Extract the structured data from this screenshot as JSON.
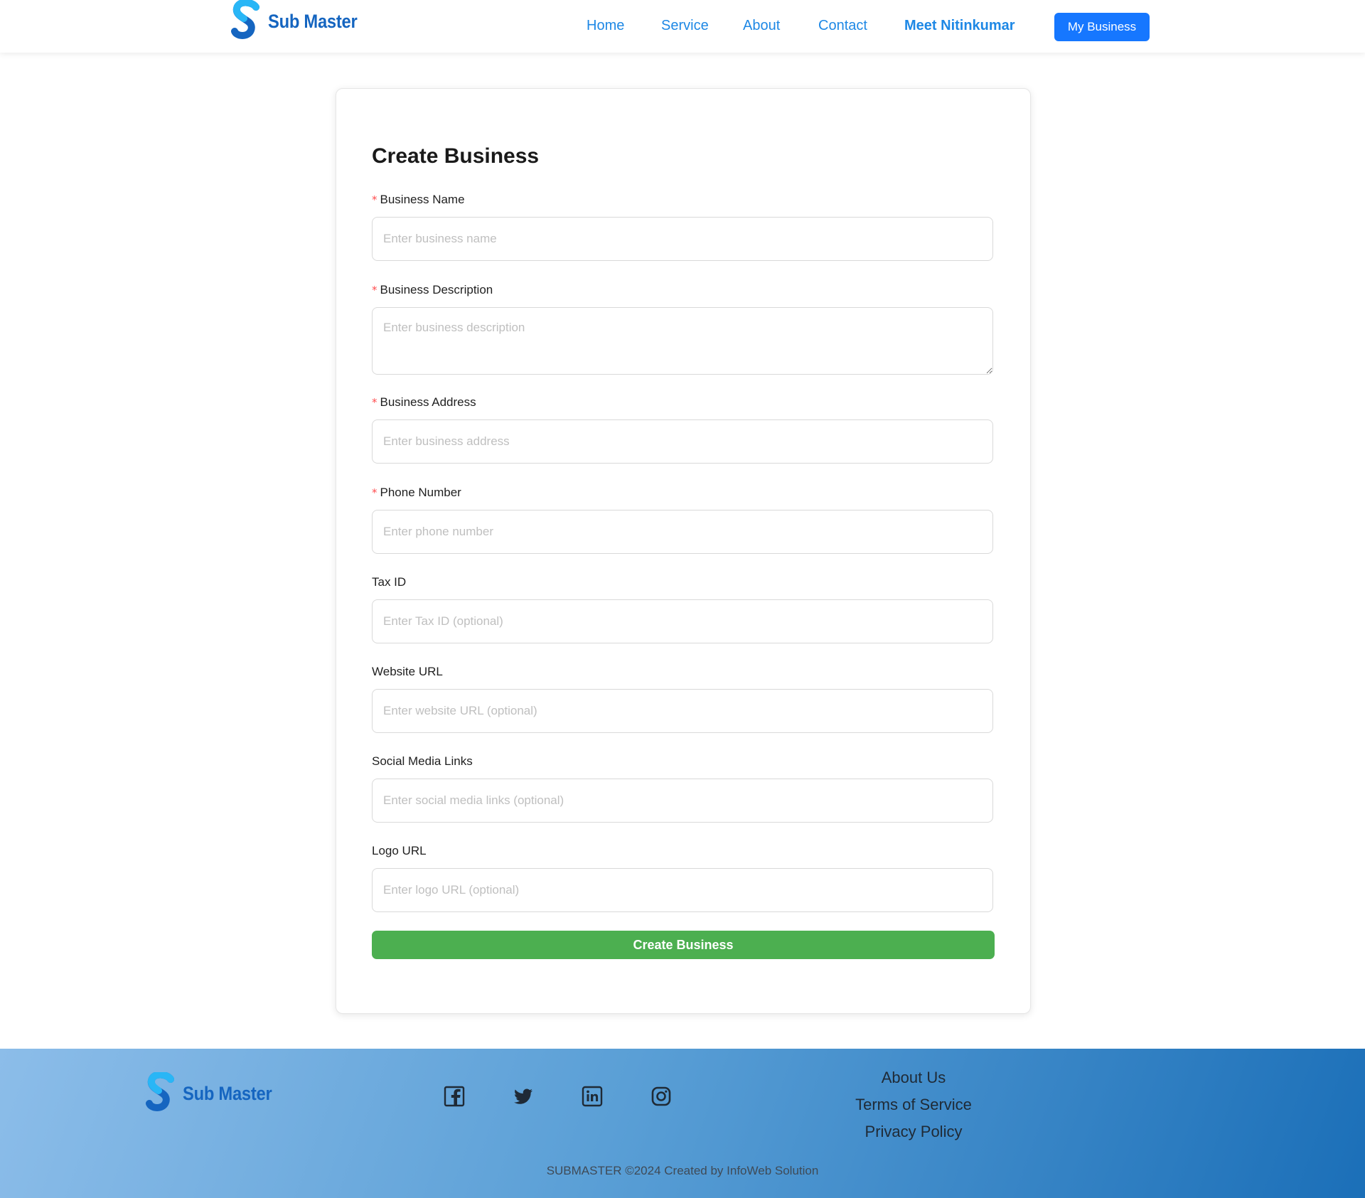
{
  "header": {
    "brand": "Sub Master",
    "nav": [
      "Home",
      "Service",
      "About",
      "Contact",
      "Meet Nitinkumar"
    ],
    "cta": "My Business"
  },
  "form": {
    "title": "Create Business",
    "fields": [
      {
        "label": "Business Name",
        "required": true,
        "placeholder": "Enter business name"
      },
      {
        "label": "Business Description",
        "required": true,
        "placeholder": "Enter business description"
      },
      {
        "label": "Business Address",
        "required": true,
        "placeholder": "Enter business address"
      },
      {
        "label": "Phone Number",
        "required": true,
        "placeholder": "Enter phone number"
      },
      {
        "label": "Tax ID",
        "required": false,
        "placeholder": "Enter Tax ID (optional)"
      },
      {
        "label": "Website URL",
        "required": false,
        "placeholder": "Enter website URL (optional)"
      },
      {
        "label": "Social Media Links",
        "required": false,
        "placeholder": "Enter social media links (optional)"
      },
      {
        "label": "Logo URL",
        "required": false,
        "placeholder": "Enter logo URL (optional)"
      }
    ],
    "required_mark": "*",
    "submit": "Create Business"
  },
  "footer": {
    "brand": "Sub Master",
    "social_icons": [
      "facebook-icon",
      "twitter-icon",
      "linkedin-icon",
      "instagram-icon"
    ],
    "links": [
      "About Us",
      "Terms of Service",
      "Privacy Policy"
    ],
    "copyright": "SUBMASTER ©2024 Created by InfoWeb Solution"
  },
  "colors": {
    "brand_blue": "#1565c0",
    "nav_blue": "#1e88e5",
    "cta_blue": "#1677ff",
    "submit_green": "#4caf50",
    "required_red": "#ff4d4f"
  }
}
